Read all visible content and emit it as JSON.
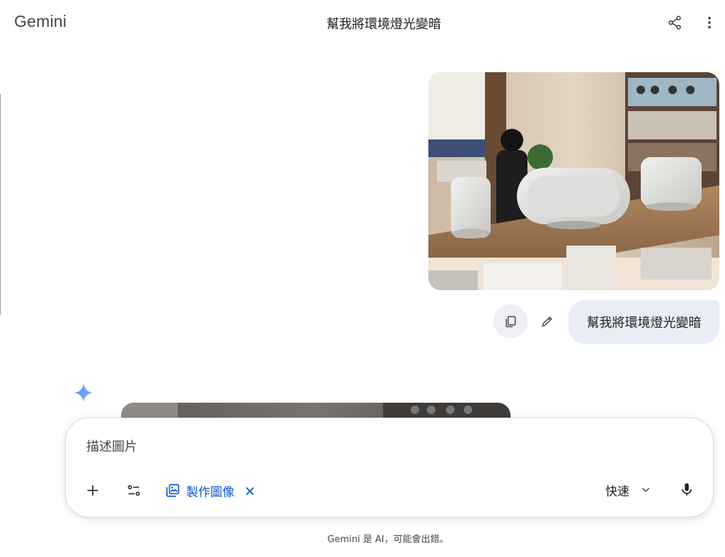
{
  "header": {
    "app_title": "Gemini",
    "chat_title": "幫我將環境燈光變暗",
    "share_icon": "share-icon",
    "more_icon": "more-vert-icon"
  },
  "conversation": {
    "user_message": {
      "image_alt": "店內展示架上的喇叭",
      "text": "幫我將環境燈光變暗",
      "copy_icon": "copy-icon",
      "edit_icon": "edit-icon"
    },
    "response": {
      "icon": "gemini-spark-icon"
    }
  },
  "input": {
    "placeholder": "描述圖片",
    "value": "",
    "add_icon": "add-icon",
    "tools_icon": "tools-icon",
    "chip_label": "製作圖像",
    "chip_icon": "image-gallery-icon",
    "chip_close_icon": "close-icon",
    "model_label": "快速",
    "model_icon": "chevron-down-icon",
    "mic_icon": "mic-icon"
  },
  "footer": {
    "disclaimer": "Gemini 是 AI，可能會出錯。"
  },
  "colors": {
    "accent": "#0b57d0",
    "user_bubble": "#e9eef6",
    "copy_button": "#eef0f3",
    "text_primary": "#1f1f1f",
    "text_secondary": "#444746"
  }
}
